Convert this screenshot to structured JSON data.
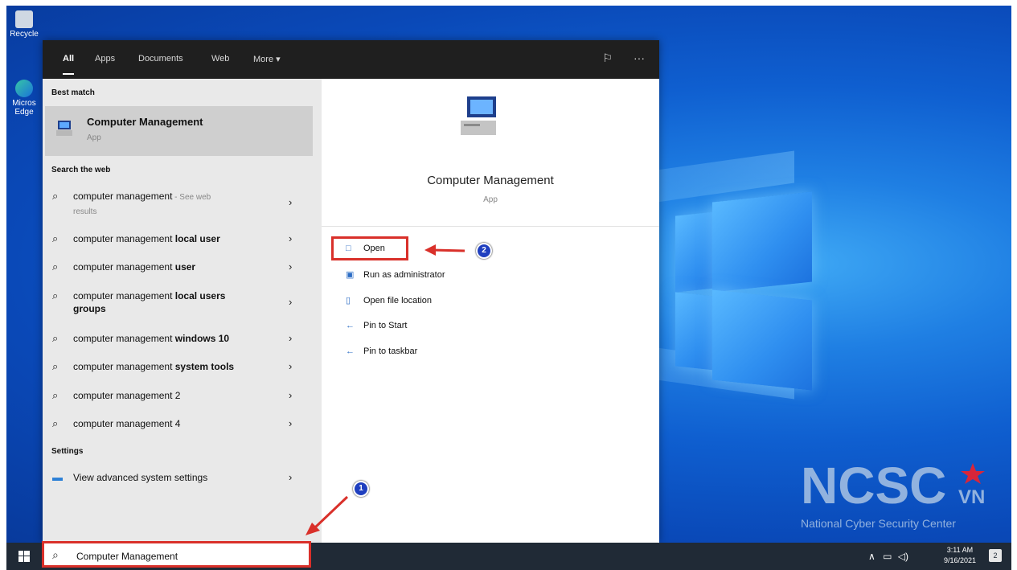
{
  "tabs": [
    "All",
    "Apps",
    "Documents",
    "Web",
    "More ▾"
  ],
  "header_icons": {
    "feedback": "feedback-icon",
    "more": "···"
  },
  "best_match": {
    "heading": "Best match",
    "title": "Computer Management",
    "subtitle": "App"
  },
  "web": {
    "heading": "Search the web",
    "items": [
      {
        "prefix": "computer management",
        "bold": "",
        "suffix": " - See web",
        "extra": "results"
      },
      {
        "prefix": "computer management ",
        "bold": "local user",
        "suffix": "",
        "extra": ""
      },
      {
        "prefix": "computer management ",
        "bold": "user",
        "suffix": "",
        "extra": ""
      },
      {
        "prefix": "computer management ",
        "bold": "local users",
        "suffix": "",
        "extra": "groups"
      },
      {
        "prefix": "computer management ",
        "bold": "windows 10",
        "suffix": "",
        "extra": ""
      },
      {
        "prefix": "computer management ",
        "bold": "system tools",
        "suffix": "",
        "extra": ""
      },
      {
        "prefix": "computer management 2",
        "bold": "",
        "suffix": "",
        "extra": ""
      },
      {
        "prefix": "computer management 4",
        "bold": "",
        "suffix": "",
        "extra": ""
      }
    ]
  },
  "settings": {
    "heading": "Settings",
    "item": "View advanced system settings"
  },
  "preview": {
    "title": "Computer Management",
    "subtitle": "App"
  },
  "actions": [
    "Open",
    "Run as administrator",
    "Open file location",
    "Pin to Start",
    "Pin to taskbar"
  ],
  "search": {
    "value": "Computer Management"
  },
  "tray": {
    "time": "3:11 AM",
    "date": "9/16/2021",
    "notification_count": "2"
  },
  "desktop_icons": [
    "Recycle",
    "Micros Edge"
  ],
  "callouts": [
    "1",
    "2"
  ],
  "logo": {
    "text": "NCSC",
    "suffix": "VN",
    "tagline": "National Cyber Security Center"
  },
  "colors": {
    "accent_red": "#d9302a",
    "callout_blue": "#1f3fbf",
    "taskbar": "#202a36"
  }
}
